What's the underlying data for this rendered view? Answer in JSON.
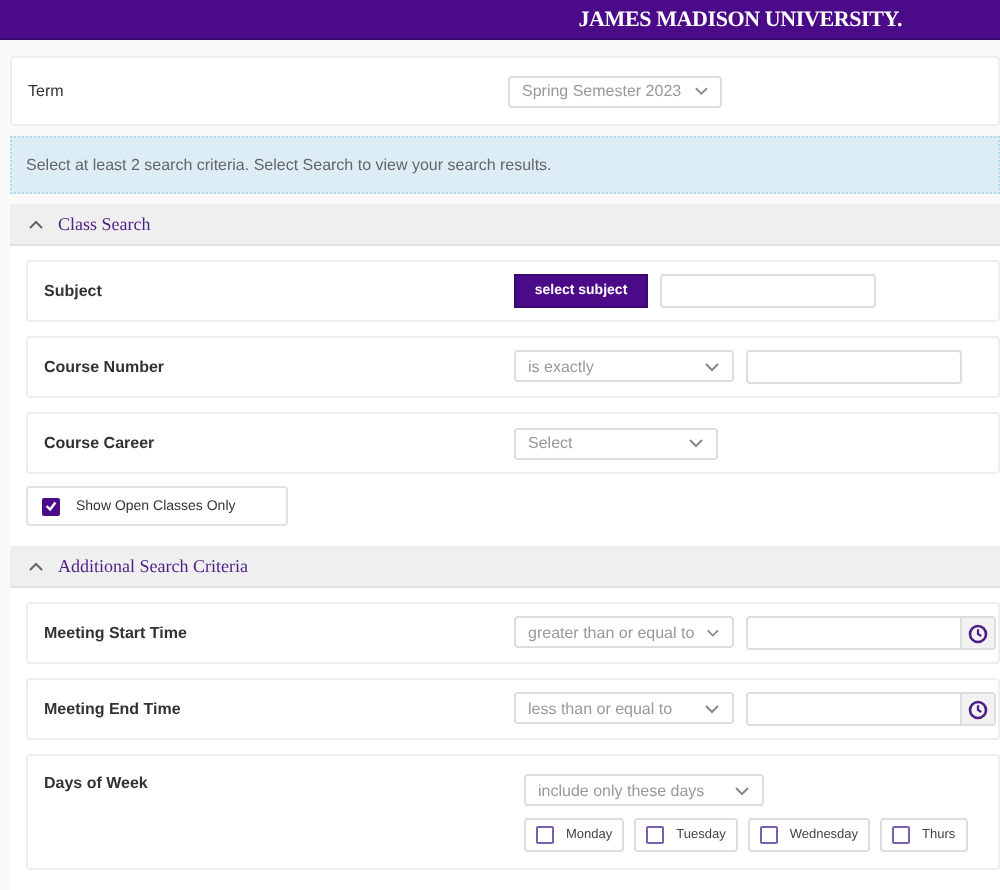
{
  "header": {
    "logo": "JAMES MADISON UNIVERSITY."
  },
  "term": {
    "label": "Term",
    "value": "Spring Semester 2023"
  },
  "info": "Select at least 2 search criteria. Select Search to view your search results.",
  "sections": [
    {
      "title": "Class Search",
      "expanded": true,
      "rows": [
        {
          "kind": "subject",
          "label": "Subject",
          "button": "select subject"
        },
        {
          "kind": "select_input",
          "label": "Course Number",
          "select": "is exactly"
        },
        {
          "kind": "select",
          "label": "Course Career",
          "select": "Select"
        }
      ],
      "checkbox": {
        "label": "Show Open Classes Only",
        "checked": true
      }
    },
    {
      "title": "Additional Search Criteria",
      "expanded": true,
      "rows": [
        {
          "kind": "time",
          "label": "Meeting Start Time",
          "select": "greater than or equal to"
        },
        {
          "kind": "time",
          "label": "Meeting End Time",
          "select": "less than or equal to"
        },
        {
          "kind": "days",
          "label": "Days of Week",
          "select": "include only these days",
          "days": [
            {
              "label": "Monday",
              "checked": false
            },
            {
              "label": "Tuesday",
              "checked": false
            },
            {
              "label": "Wednesday",
              "checked": false
            },
            {
              "label": "Thurs",
              "checked": false
            }
          ]
        }
      ]
    }
  ]
}
